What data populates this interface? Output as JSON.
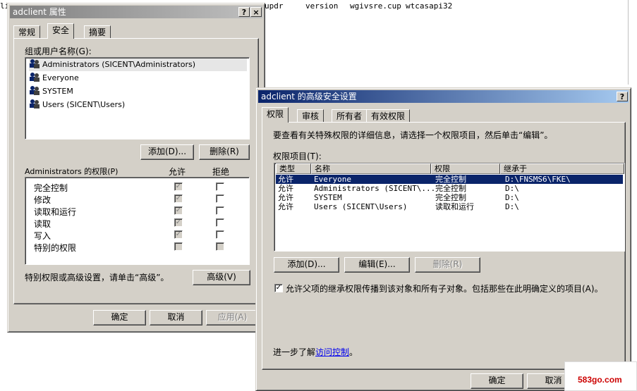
{
  "background_text": {
    "left_fragment": "li",
    "files": [
      "updr",
      "version",
      "wgivsre.cup",
      "wtcasapi32"
    ]
  },
  "props_window": {
    "title": "adclient 属性",
    "help_btn": "?",
    "close_btn": "×",
    "tabs": [
      "常规",
      "安全",
      "摘要"
    ],
    "group_label": "组或用户名称(G):",
    "users": [
      "Administrators (SICENT\\Administrators)",
      "Everyone",
      "SYSTEM",
      "Users (SICENT\\Users)"
    ],
    "add_btn": "添加(D)...",
    "remove_btn": "删除(R)",
    "perm_header": "Administrators 的权限(P)",
    "allow_col": "允许",
    "deny_col": "拒绝",
    "permissions": [
      {
        "name": "完全控制",
        "allow": true,
        "deny": false
      },
      {
        "name": "修改",
        "allow": true,
        "deny": false
      },
      {
        "name": "读取和运行",
        "allow": true,
        "deny": false
      },
      {
        "name": "读取",
        "allow": true,
        "deny": false
      },
      {
        "name": "写入",
        "allow": true,
        "deny": false
      },
      {
        "name": "特别的权限",
        "allow": false,
        "deny": false
      }
    ],
    "advanced_hint": "特别权限或高级设置，请单击“高级”。",
    "advanced_btn": "高级(V)",
    "ok_btn": "确定",
    "cancel_btn": "取消",
    "apply_btn": "应用(A)"
  },
  "adv_window": {
    "title": "adclient 的高级安全设置",
    "help_btn": "?",
    "tabs": [
      "权限",
      "审核",
      "所有者",
      "有效权限"
    ],
    "instructions": "要查看有关特殊权限的详细信息，请选择一个权限项目，然后单击“编辑”。",
    "entries_label": "权限项目(T):",
    "columns": [
      "类型",
      "名称",
      "权限",
      "继承于"
    ],
    "entries": [
      {
        "type": "允许",
        "name": "Everyone",
        "perm": "完全控制",
        "inherit": "D:\\FNSMS6\\FKE\\"
      },
      {
        "type": "允许",
        "name": "Administrators (SICENT\\...",
        "perm": "完全控制",
        "inherit": "D:\\"
      },
      {
        "type": "允许",
        "name": "SYSTEM",
        "perm": "完全控制",
        "inherit": "D:\\"
      },
      {
        "type": "允许",
        "name": "Users (SICENT\\Users)",
        "perm": "读取和运行",
        "inherit": "D:\\"
      }
    ],
    "add_btn": "添加(D)...",
    "edit_btn": "编辑(E)...",
    "remove_btn": "删除(R)",
    "inherit_checkbox": "允许父项的继承权限传播到该对象和所有子对象。包括那些在此明确定义的项目(A)。",
    "learn_more_prefix": "进一步了解",
    "learn_more_link": "访问控制",
    "learn_more_suffix": "。",
    "ok_btn": "确定",
    "cancel_btn": "取消"
  },
  "watermark": {
    "text": "583go.com"
  },
  "colors": {
    "active_title": "#0a246a",
    "inactive_title": "#808080",
    "face": "#d4d0c8",
    "selection": "#0a246a",
    "watermark": "#cc0000"
  }
}
